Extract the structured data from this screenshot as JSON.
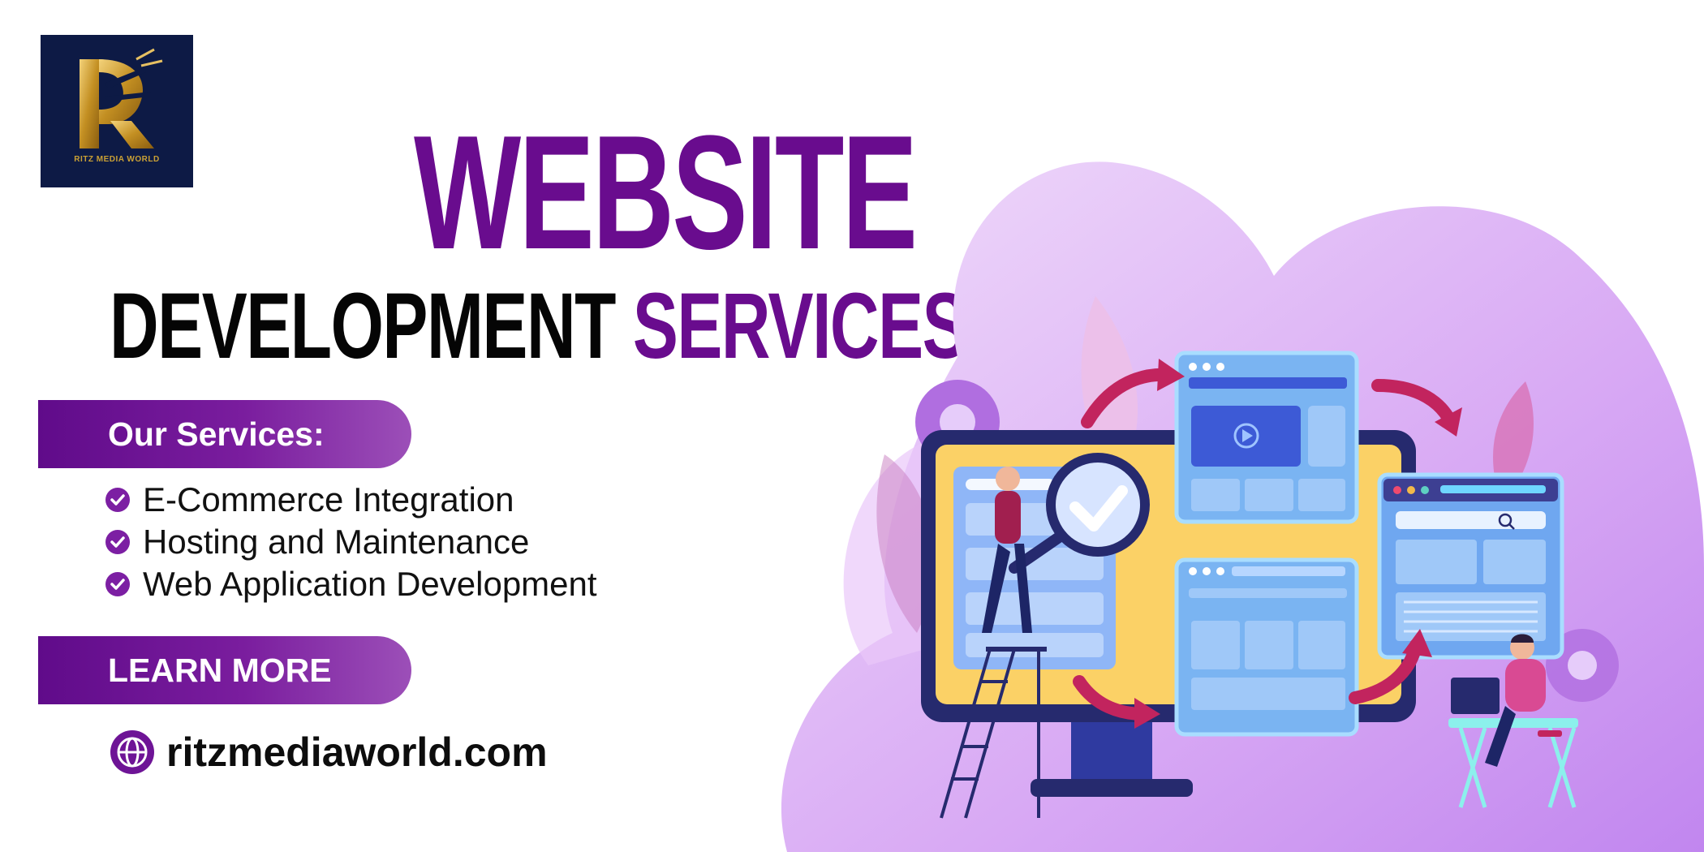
{
  "brand": {
    "logo_text": "RITZ MEDIA WORLD",
    "colors": {
      "purple": "#690c8e",
      "navy": "#0d1a45",
      "gold": "#c9a035"
    }
  },
  "headline": {
    "line1": "WEBSITE",
    "line2_dark": "DEVELOPMENT",
    "line2_accent": "SERVICES"
  },
  "services": {
    "heading": "Our Services:",
    "items": [
      {
        "label": "E-Commerce Integration",
        "icon": "check-circle-icon"
      },
      {
        "label": "Hosting and Maintenance",
        "icon": "check-circle-icon"
      },
      {
        "label": "Web Application Development",
        "icon": "check-circle-icon"
      }
    ]
  },
  "cta": {
    "label": "LEARN MORE"
  },
  "website": {
    "url": "ritzmediaworld.com",
    "icon": "globe-icon"
  }
}
